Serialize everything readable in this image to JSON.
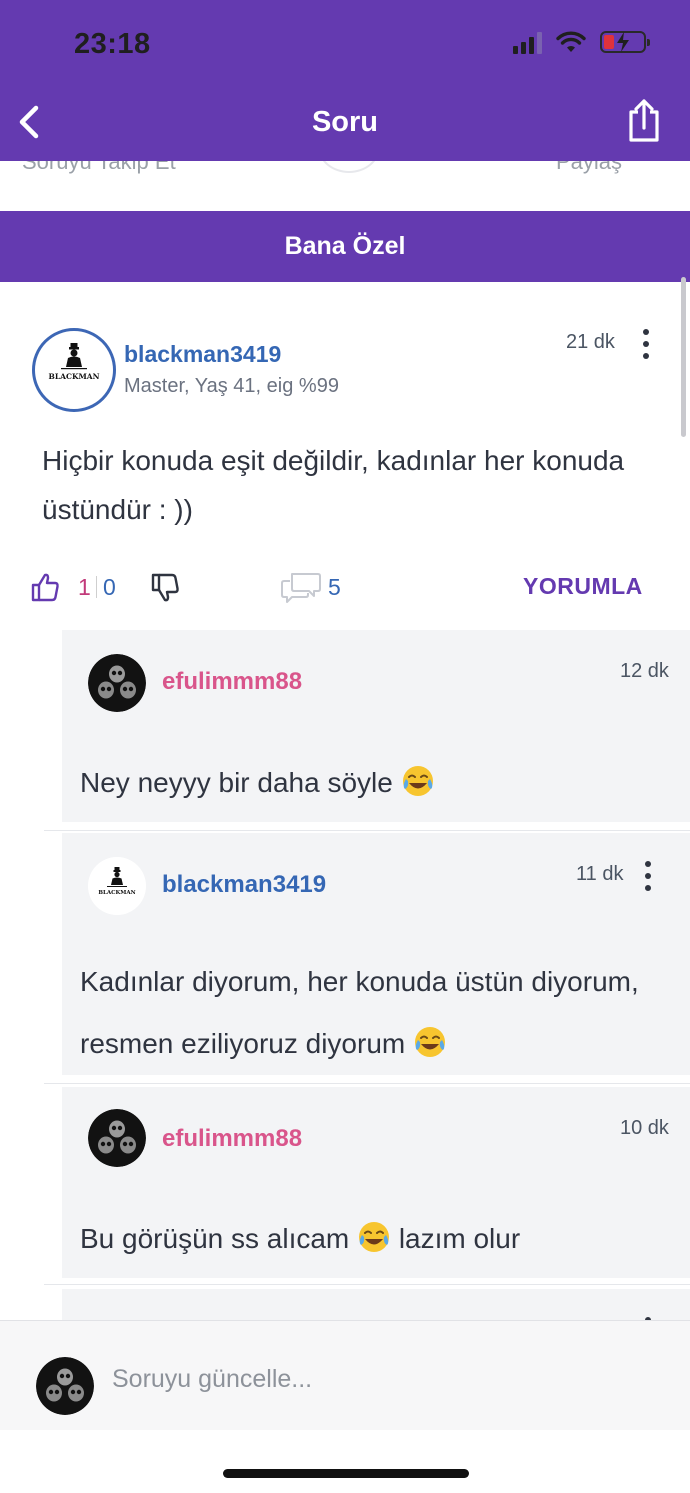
{
  "status_bar": {
    "time": "23:18"
  },
  "header": {
    "title": "Soru"
  },
  "peek": {
    "left_label": "Soruyu Takip Et",
    "right_label": "Paylaş"
  },
  "tab": {
    "label": "Bana Özel"
  },
  "question": {
    "username": "blackman3419",
    "meta": "Master, Yaş 41, eig %99",
    "time": "21 dk",
    "avatar_logo_text": "BLACKMAN",
    "text": "Hiçbir konuda eşit değildir, kadınlar her konuda üstündür : ))",
    "likes": "1",
    "dislikes": "0",
    "comments": "5",
    "comment_action": "YORUMLA"
  },
  "comments": [
    {
      "username": "efulimmm88",
      "time": "12 dk",
      "text": "Ney neyyy bir daha söyle",
      "emoji": "joy"
    },
    {
      "username": "blackman3419",
      "time": "11 dk",
      "text": "Kadınlar diyorum, her konuda üstün diyorum, resmen eziliyoruz diyorum",
      "emoji": "joy"
    },
    {
      "username": "efulimmm88",
      "time": "10 dk",
      "text_before": "Bu görüşün ss alıcam",
      "text_after": "lazım olur",
      "emoji": "joy"
    }
  ],
  "composer": {
    "placeholder": "Soruyu güncelle..."
  },
  "colors": {
    "brand": "#643ab0",
    "link_blue": "#3567b4",
    "pink": "#d9558b",
    "like": "#c23a7a"
  }
}
